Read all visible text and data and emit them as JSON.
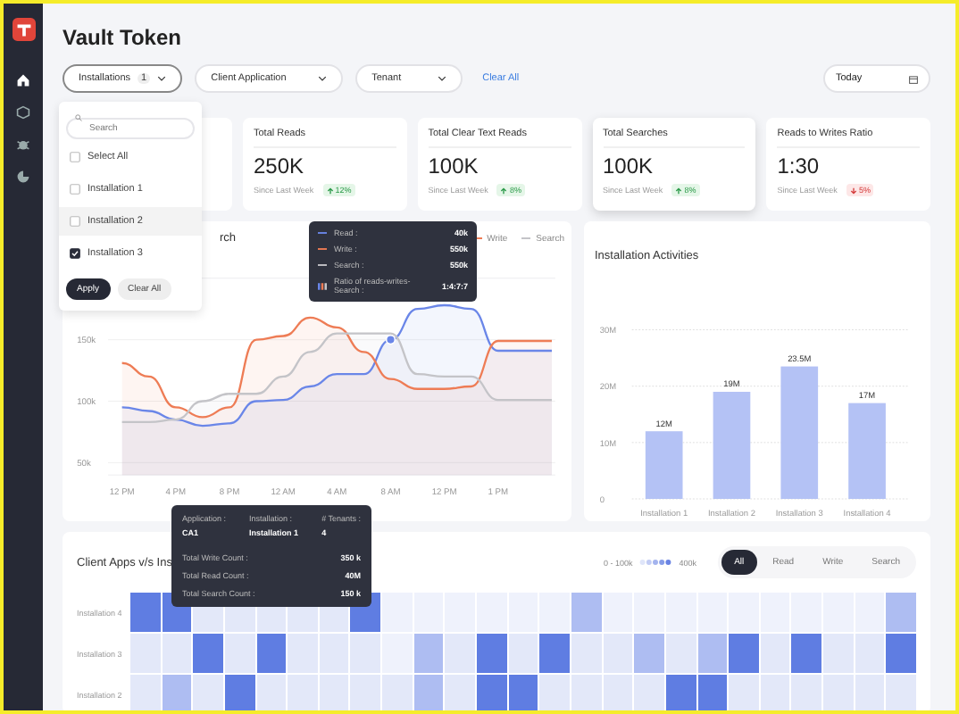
{
  "title": "Vault Token",
  "filters": [
    {
      "label": "Installations",
      "badge": "1",
      "open": true
    },
    {
      "label": "Client Application",
      "open": false
    },
    {
      "label": "Tenant",
      "open": false
    }
  ],
  "clear_all": "Clear All",
  "date_field": {
    "value": "Today"
  },
  "dropdown": {
    "search_placeholder": "Search",
    "options": [
      {
        "label": "Select All",
        "checked": false,
        "highlighted": false
      },
      {
        "label": "Installation 1",
        "checked": false,
        "highlighted": false
      },
      {
        "label": "Installation 2",
        "checked": false,
        "highlighted": true
      },
      {
        "label": "Installation 3",
        "checked": true,
        "highlighted": false
      }
    ],
    "apply": "Apply",
    "clear": "Clear All"
  },
  "kpi_cards": [
    {
      "kind": "hidden"
    },
    {
      "kind": "stat",
      "title": "Total Reads",
      "value": "250K",
      "since": "Since Last Week",
      "change": {
        "kind": "up",
        "text": "12%"
      },
      "raised": false
    },
    {
      "kind": "stat",
      "title": "Total Clear Text Reads",
      "value": "100K",
      "since": "Since Last Week",
      "change": {
        "kind": "up",
        "text": "8%"
      },
      "raised": false
    },
    {
      "kind": "stat",
      "title": "Total Searches",
      "value": "100K",
      "since": "Since Last Week",
      "change": {
        "kind": "up",
        "text": "8%"
      },
      "raised": true
    },
    {
      "kind": "stat",
      "title": "Reads to Writes Ratio",
      "value": "1:30",
      "since": "Since Last Week",
      "change": {
        "kind": "down",
        "text": "5%"
      },
      "raised": false
    }
  ],
  "line_card": {
    "title": "rch",
    "legend": [
      {
        "label": "Write",
        "color": "#ee7c55"
      },
      {
        "label": "Search",
        "color": "#c4c4c8"
      }
    ],
    "chart_data": {
      "type": "area",
      "grid": true,
      "categories": [
        "12 PM",
        null,
        "4 PM",
        null,
        "8 PM",
        null,
        "12 AM",
        null,
        "4 AM",
        null,
        "8 AM",
        null,
        "12 PM",
        null,
        "1 PM",
        null,
        null
      ],
      "series": [
        {
          "color": "#6a86e8",
          "values": [
            95,
            92,
            85,
            80,
            82,
            100,
            101,
            112,
            122,
            122,
            150,
            175,
            178,
            175,
            141,
            141,
            141
          ]
        },
        {
          "color": "#ee7c55",
          "values": [
            131,
            120,
            95,
            87,
            95,
            150,
            153,
            168,
            160,
            140,
            118,
            110,
            110,
            112,
            149,
            149,
            149
          ]
        },
        {
          "color": "#c4c4c8",
          "values": [
            83,
            83,
            85,
            100,
            106,
            106,
            120,
            140,
            155,
            155,
            155,
            122,
            120,
            120,
            101,
            101,
            101
          ]
        }
      ],
      "ylim": [
        40,
        200
      ],
      "yticks": [
        {
          "value": 50,
          "label": "50k"
        },
        {
          "value": 100,
          "label": "100k"
        },
        {
          "value": 150,
          "label": "150k"
        }
      ]
    },
    "tooltip": {
      "rows": [
        {
          "label": "Read :",
          "value": "40k"
        },
        {
          "label": "Write :",
          "value": "550k"
        },
        {
          "label": "Search :",
          "value": "550k"
        },
        {
          "label": "Ratio of reads-writes-Search :",
          "value": "1:4:7:7"
        }
      ]
    }
  },
  "bar_card": {
    "title": "Installation Activities",
    "chart_data": {
      "type": "bar",
      "categories": [
        "Installation 1",
        "Installation 2",
        "Installation 3",
        "Installation 4"
      ],
      "values": [
        12,
        19,
        23.5,
        17
      ],
      "ylim": [
        0,
        30
      ],
      "yticks": [
        {
          "value": 0,
          "label": "0"
        },
        {
          "value": 10,
          "label": "10M"
        },
        {
          "value": 20,
          "label": "20M"
        },
        {
          "value": 30,
          "label": "30M"
        }
      ],
      "data_labels": true,
      "value_labels": [
        "12M",
        "19M",
        "23.5M",
        "17M"
      ]
    }
  },
  "heatmap_card": {
    "title": "Client Apps v/s Ins",
    "legend": {
      "low": "0 - 100k",
      "high": "400k"
    },
    "toggles": [
      {
        "label": "All",
        "selected": true
      },
      {
        "label": "Read",
        "selected": false
      },
      {
        "label": "Write",
        "selected": false
      },
      {
        "label": "Search",
        "selected": false
      }
    ],
    "rows": [
      {
        "label": "Installation 4",
        "cells": [
          {
            "color": "#5f7de2"
          },
          {
            "color": "#5f7de2"
          },
          {
            "color": "#e3e8f9"
          },
          {
            "color": "#e3e8f9"
          },
          {
            "color": "#e3e8f9"
          },
          {
            "color": "#e3e8f9"
          },
          {
            "color": "#e3e8f9"
          },
          {
            "color": "#5f7de2"
          },
          {
            "color": "#eff2fc"
          },
          {
            "color": "#eff2fc"
          },
          {
            "color": "#eff2fc"
          },
          {
            "color": "#eff2fc"
          },
          {
            "color": "#eff2fc"
          },
          {
            "color": "#eff2fc"
          },
          {
            "color": "#aebdf2"
          },
          {
            "color": "#eff2fc"
          },
          {
            "color": "#eff2fc"
          },
          {
            "color": "#eff2fc"
          },
          {
            "color": "#eff2fc"
          },
          {
            "color": "#eff2fc"
          },
          {
            "color": "#eff2fc"
          },
          {
            "color": "#eff2fc"
          },
          {
            "color": "#eff2fc"
          },
          {
            "color": "#eff2fc"
          },
          {
            "color": "#aebdf2"
          }
        ]
      },
      {
        "label": "Installation 3",
        "cells": [
          {
            "color": "#e3e8f9"
          },
          {
            "color": "#e3e8f9"
          },
          {
            "color": "#5f7de2"
          },
          {
            "color": "#e3e8f9"
          },
          {
            "color": "#5f7de2"
          },
          {
            "color": "#e3e8f9"
          },
          {
            "color": "#e3e8f9"
          },
          {
            "color": "#e3e8f9"
          },
          {
            "color": "#eff2fc"
          },
          {
            "color": "#aebdf2"
          },
          {
            "color": "#e3e8f9"
          },
          {
            "color": "#5f7de2"
          },
          {
            "color": "#e3e8f9"
          },
          {
            "color": "#5f7de2"
          },
          {
            "color": "#e3e8f9"
          },
          {
            "color": "#e3e8f9"
          },
          {
            "color": "#aebdf2"
          },
          {
            "color": "#e3e8f9"
          },
          {
            "color": "#aebdf2"
          },
          {
            "color": "#5f7de2"
          },
          {
            "color": "#e3e8f9"
          },
          {
            "color": "#5f7de2"
          },
          {
            "color": "#e3e8f9"
          },
          {
            "color": "#e3e8f9"
          },
          {
            "color": "#5f7de2"
          }
        ]
      },
      {
        "label": "Installation 2",
        "cells": [
          {
            "color": "#e3e8f9"
          },
          {
            "color": "#aebdf2"
          },
          {
            "color": "#e3e8f9"
          },
          {
            "color": "#5f7de2"
          },
          {
            "color": "#e3e8f9"
          },
          {
            "color": "#e3e8f9"
          },
          {
            "color": "#e3e8f9"
          },
          {
            "color": "#e3e8f9"
          },
          {
            "color": "#e3e8f9"
          },
          {
            "color": "#aebdf2"
          },
          {
            "color": "#e3e8f9"
          },
          {
            "color": "#5f7de2"
          },
          {
            "color": "#5f7de2"
          },
          {
            "color": "#e3e8f9"
          },
          {
            "color": "#e3e8f9"
          },
          {
            "color": "#e3e8f9"
          },
          {
            "color": "#e3e8f9"
          },
          {
            "color": "#5f7de2"
          },
          {
            "color": "#5f7de2"
          },
          {
            "color": "#e3e8f9"
          },
          {
            "color": "#e3e8f9"
          },
          {
            "color": "#e3e8f9"
          },
          {
            "color": "#e3e8f9"
          },
          {
            "color": "#e3e8f9"
          },
          {
            "color": "#e3e8f9"
          }
        ]
      }
    ],
    "tooltip": {
      "head": [
        {
          "label": "Application :",
          "value": "CA1"
        },
        {
          "label": "Installation :",
          "value": "Installation 1"
        },
        {
          "label": "# Tenants :",
          "value": "4"
        }
      ],
      "rows": [
        {
          "label": "Total Write Count :",
          "value": "350 k"
        },
        {
          "label": "Total Read Count :",
          "value": "40M"
        },
        {
          "label": "Total Search Count :",
          "value": "150 k"
        }
      ]
    }
  }
}
